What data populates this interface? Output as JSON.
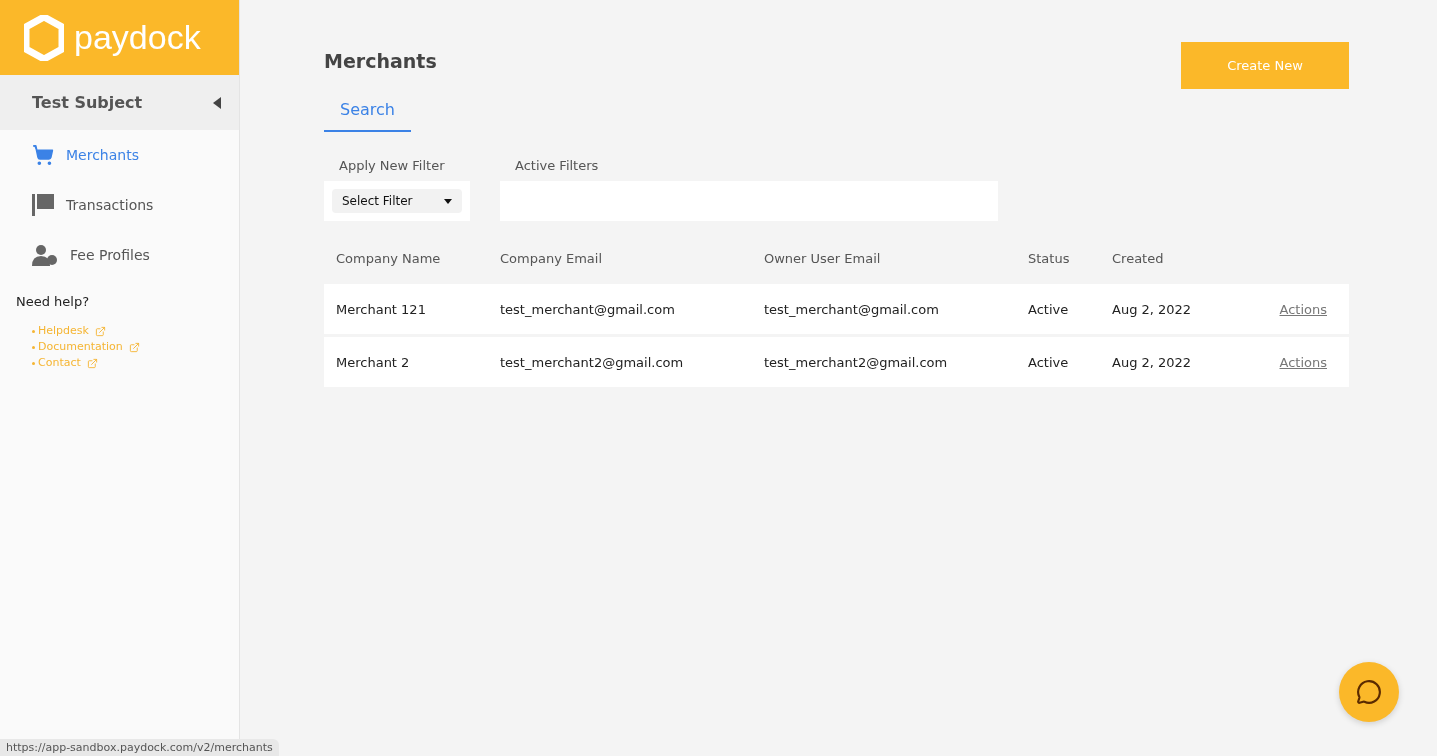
{
  "logo": {
    "text": "paydock"
  },
  "account": {
    "name": "Test Subject"
  },
  "nav": [
    {
      "label": "Merchants",
      "kind": "cart",
      "selected": true
    },
    {
      "label": "Transactions",
      "kind": "flag",
      "selected": false
    },
    {
      "label": "Fee Profiles",
      "kind": "user",
      "selected": false
    }
  ],
  "help": {
    "title": "Need help?",
    "links": [
      "Helpdesk",
      "Documentation",
      "Contact"
    ]
  },
  "page": {
    "title": "Merchants",
    "create_button": "Create New"
  },
  "tabs": [
    {
      "label": "Search",
      "selected": true
    }
  ],
  "filters": {
    "apply_label": "Apply New Filter",
    "select_placeholder": "Select Filter",
    "active_label": "Active Filters"
  },
  "table": {
    "columns": [
      "Company Name",
      "Company Email",
      "Owner User Email",
      "Status",
      "Created"
    ],
    "rows": [
      {
        "cells": [
          "Merchant 121",
          "test_merchant@gmail.com",
          "test_merchant@gmail.com",
          "Active",
          "Aug 2, 2022"
        ],
        "action": "Actions"
      },
      {
        "cells": [
          "Merchant 2",
          "test_merchant2@gmail.com",
          "test_merchant2@gmail.com",
          "Active",
          "Aug 2, 2022"
        ],
        "action": "Actions"
      }
    ]
  },
  "status_bar": {
    "url": "https://app-sandbox.paydock.com/v2/merchants"
  }
}
